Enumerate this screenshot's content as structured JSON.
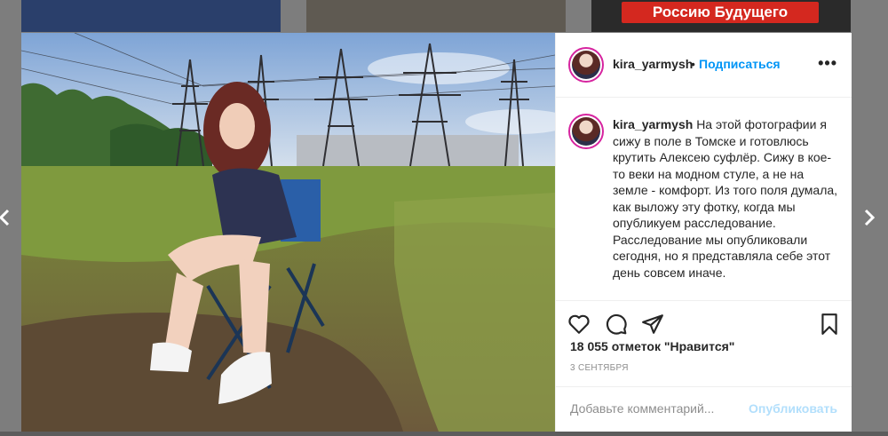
{
  "background": {
    "banner_text": "Россию Будущего"
  },
  "post": {
    "username": "kira_yarmysh",
    "separator": "•",
    "follow_label": "Подписаться",
    "more_label": "•••",
    "caption": {
      "username": "kira_yarmysh",
      "text": "На этой фотографии я сижу в поле в Томске и готовлюсь крутить Алексею суфлёр. Сижу в кое-то веки на модном стуле, а не на земле - комфорт. Из того поля думала, как выложу эту фотку, когда мы опубликуем расследование. Расследование мы опубликовали сегодня, но я представляла себе этот день совсем иначе."
    },
    "likes": "18 055 отметок \"Нравится\"",
    "date": "3 СЕНТЯБРЯ",
    "comment_placeholder": "Добавьте комментарий...",
    "post_button": "Опубликовать"
  },
  "icons": {
    "prev": "chevron-left-icon",
    "next": "chevron-right-icon",
    "like": "heart-icon",
    "comment": "comment-icon",
    "share": "paper-plane-icon",
    "save": "bookmark-icon"
  },
  "colors": {
    "accent": "#0095f6",
    "post_disabled": "#b2dffc",
    "banner": "#d4281f"
  }
}
